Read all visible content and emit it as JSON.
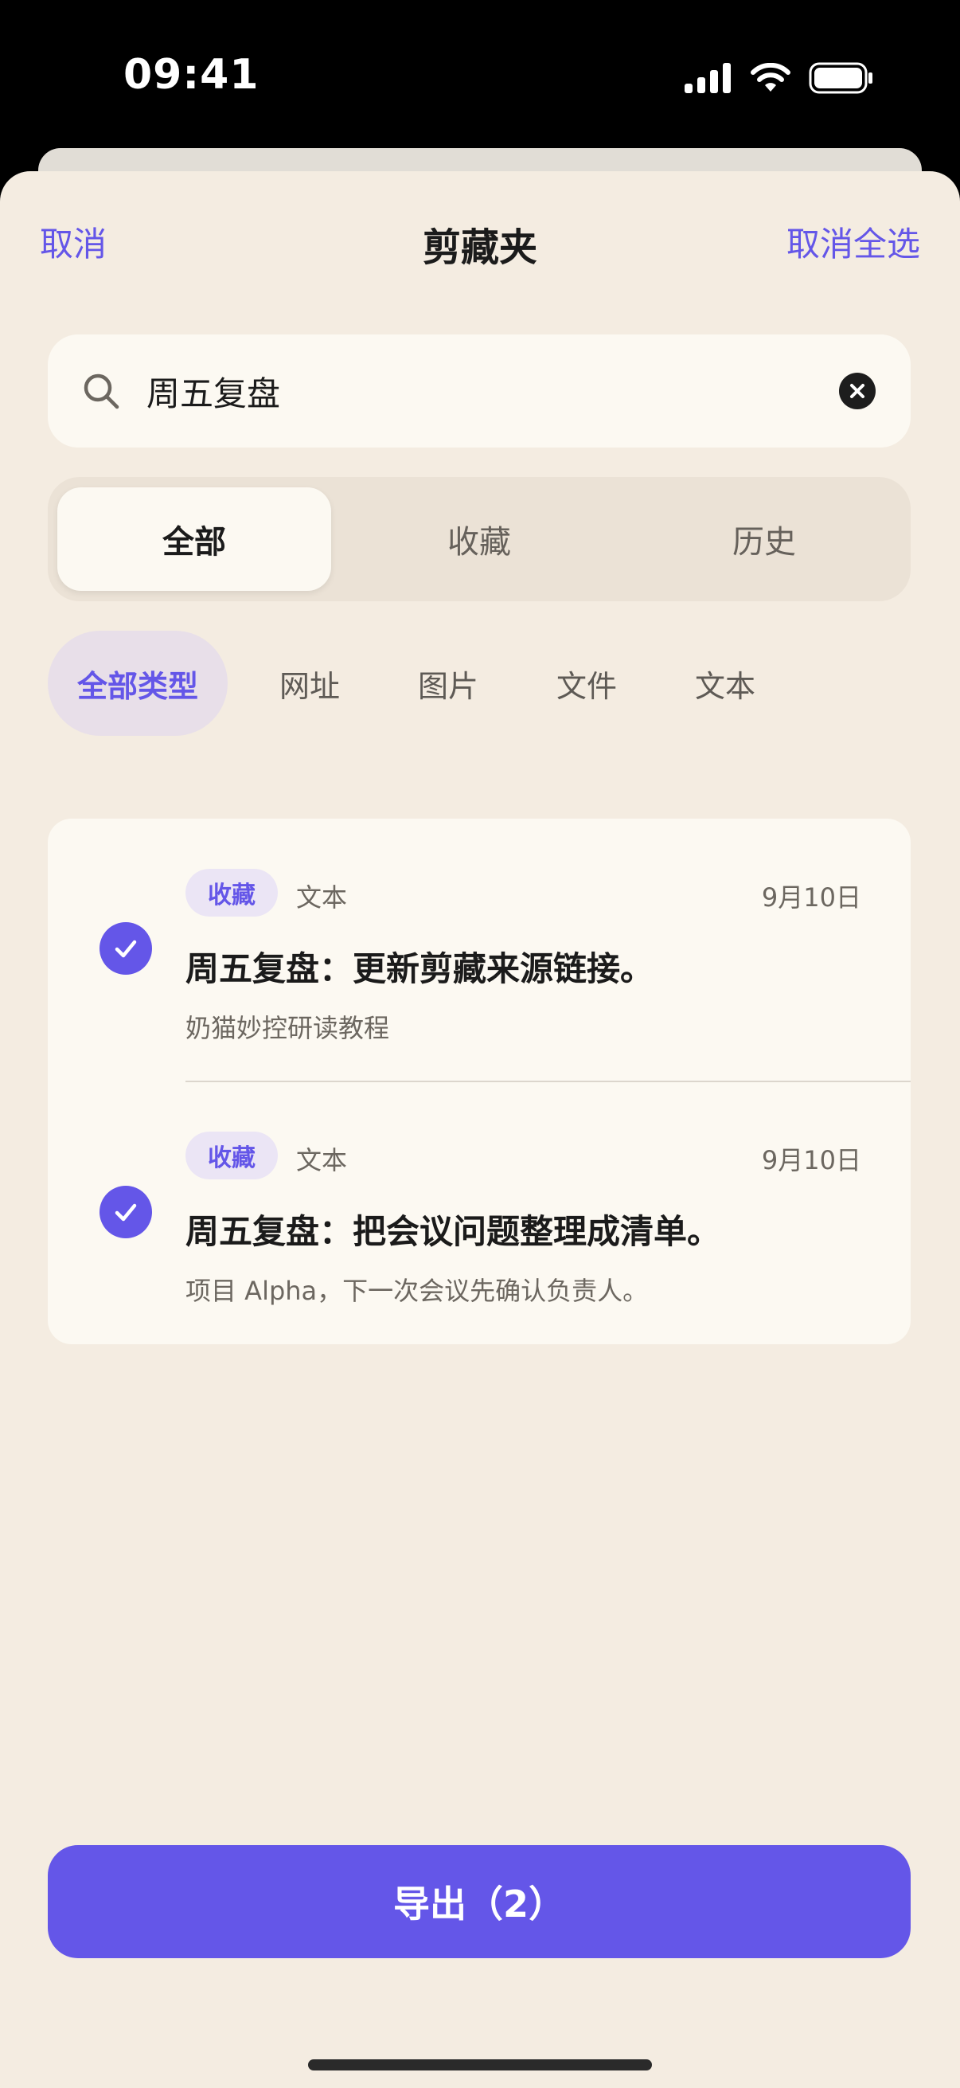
{
  "status_bar": {
    "time": "09:41",
    "icons": [
      "cellular-signal-icon",
      "wifi-icon",
      "battery-icon"
    ]
  },
  "header": {
    "cancel_label": "取消",
    "title": "剪藏夹",
    "deselect_all_label": "取消全选"
  },
  "search": {
    "value": "周五复盘",
    "icon": "search-icon",
    "clear_icon": "clear-icon"
  },
  "segments": {
    "items": [
      {
        "label": "全部",
        "active": true
      },
      {
        "label": "收藏",
        "active": false
      },
      {
        "label": "历史",
        "active": false
      }
    ]
  },
  "filters": {
    "items": [
      {
        "label": "全部类型",
        "active": true
      },
      {
        "label": "网址",
        "active": false
      },
      {
        "label": "图片",
        "active": false
      },
      {
        "label": "文件",
        "active": false
      },
      {
        "label": "文本",
        "active": false
      }
    ]
  },
  "list": {
    "items": [
      {
        "selected": true,
        "badge": "收藏",
        "type": "文本",
        "date": "9月10日",
        "title": "周五复盘：更新剪藏来源链接。",
        "subtitle": "奶猫妙控研读教程"
      },
      {
        "selected": true,
        "badge": "收藏",
        "type": "文本",
        "date": "9月10日",
        "title": "周五复盘：把会议问题整理成清单。",
        "subtitle": "项目 Alpha，下一次会议先确认负责人。"
      }
    ]
  },
  "export": {
    "label": "导出（2）"
  },
  "colors": {
    "accent": "#6456e8",
    "sheet_background": "#f4ece1",
    "card_background": "#fcf9f2",
    "segment_track": "#ebe2d6",
    "chip_active_background": "#e8dfe9",
    "text_primary": "#1b1b1b",
    "text_secondary": "#6c6760"
  }
}
